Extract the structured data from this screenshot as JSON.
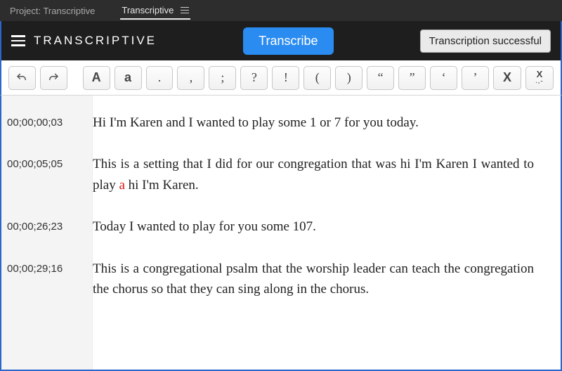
{
  "topbar": {
    "project": "Project: Transcriptive",
    "tab": "Transcriptive"
  },
  "mainbar": {
    "brand": "TRANSCRIPTIVE",
    "transcribe": "Transcribe",
    "status": "Transcription successful"
  },
  "toolbar": {
    "upper": "A",
    "lower": "a",
    "punct": {
      "period": ".",
      "comma": ",",
      "semi": ";",
      "question": "?",
      "bang": "!",
      "lparen": "(",
      "rparen": ")",
      "ldquo": "“",
      "rdquo": "”",
      "lsquo": "‘",
      "rsquo": "’"
    },
    "x": "X",
    "x_sub": ".,-"
  },
  "segments": [
    {
      "tc": "00;00;00;03",
      "text": "Hi I'm Karen and I wanted to play some 1 or 7 for you today."
    },
    {
      "tc": "00;00;05;05",
      "text_pre": "This is a setting that I did for our congregation that was hi I'm Karen I wanted to play ",
      "text_low": "a",
      "text_post": " hi I'm Karen."
    },
    {
      "tc": "00;00;26;23",
      "text": "Today I wanted to play for you some 107."
    },
    {
      "tc": "00;00;29;16",
      "text": "This is a congregational psalm that the worship leader can teach the congregation the chorus so that they can sing along in the chorus."
    }
  ]
}
